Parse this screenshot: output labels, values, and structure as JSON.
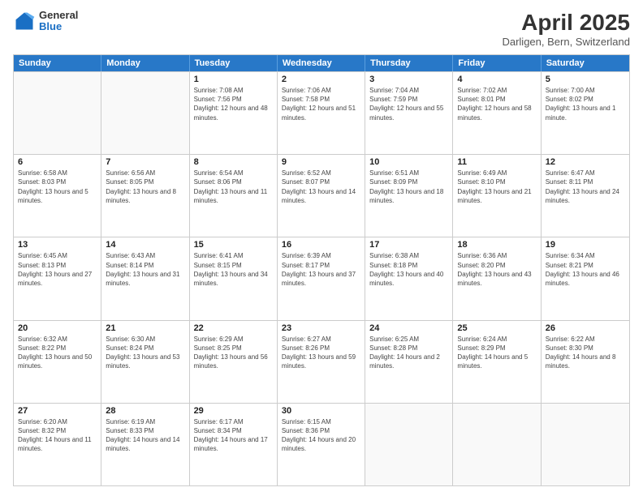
{
  "header": {
    "logo_general": "General",
    "logo_blue": "Blue",
    "title": "April 2025",
    "location": "Darligen, Bern, Switzerland"
  },
  "days_of_week": [
    "Sunday",
    "Monday",
    "Tuesday",
    "Wednesday",
    "Thursday",
    "Friday",
    "Saturday"
  ],
  "weeks": [
    [
      {
        "day": "",
        "empty": true
      },
      {
        "day": "",
        "empty": true
      },
      {
        "day": "1",
        "sunrise": "Sunrise: 7:08 AM",
        "sunset": "Sunset: 7:56 PM",
        "daylight": "Daylight: 12 hours and 48 minutes."
      },
      {
        "day": "2",
        "sunrise": "Sunrise: 7:06 AM",
        "sunset": "Sunset: 7:58 PM",
        "daylight": "Daylight: 12 hours and 51 minutes."
      },
      {
        "day": "3",
        "sunrise": "Sunrise: 7:04 AM",
        "sunset": "Sunset: 7:59 PM",
        "daylight": "Daylight: 12 hours and 55 minutes."
      },
      {
        "day": "4",
        "sunrise": "Sunrise: 7:02 AM",
        "sunset": "Sunset: 8:01 PM",
        "daylight": "Daylight: 12 hours and 58 minutes."
      },
      {
        "day": "5",
        "sunrise": "Sunrise: 7:00 AM",
        "sunset": "Sunset: 8:02 PM",
        "daylight": "Daylight: 13 hours and 1 minute."
      }
    ],
    [
      {
        "day": "6",
        "sunrise": "Sunrise: 6:58 AM",
        "sunset": "Sunset: 8:03 PM",
        "daylight": "Daylight: 13 hours and 5 minutes."
      },
      {
        "day": "7",
        "sunrise": "Sunrise: 6:56 AM",
        "sunset": "Sunset: 8:05 PM",
        "daylight": "Daylight: 13 hours and 8 minutes."
      },
      {
        "day": "8",
        "sunrise": "Sunrise: 6:54 AM",
        "sunset": "Sunset: 8:06 PM",
        "daylight": "Daylight: 13 hours and 11 minutes."
      },
      {
        "day": "9",
        "sunrise": "Sunrise: 6:52 AM",
        "sunset": "Sunset: 8:07 PM",
        "daylight": "Daylight: 13 hours and 14 minutes."
      },
      {
        "day": "10",
        "sunrise": "Sunrise: 6:51 AM",
        "sunset": "Sunset: 8:09 PM",
        "daylight": "Daylight: 13 hours and 18 minutes."
      },
      {
        "day": "11",
        "sunrise": "Sunrise: 6:49 AM",
        "sunset": "Sunset: 8:10 PM",
        "daylight": "Daylight: 13 hours and 21 minutes."
      },
      {
        "day": "12",
        "sunrise": "Sunrise: 6:47 AM",
        "sunset": "Sunset: 8:11 PM",
        "daylight": "Daylight: 13 hours and 24 minutes."
      }
    ],
    [
      {
        "day": "13",
        "sunrise": "Sunrise: 6:45 AM",
        "sunset": "Sunset: 8:13 PM",
        "daylight": "Daylight: 13 hours and 27 minutes."
      },
      {
        "day": "14",
        "sunrise": "Sunrise: 6:43 AM",
        "sunset": "Sunset: 8:14 PM",
        "daylight": "Daylight: 13 hours and 31 minutes."
      },
      {
        "day": "15",
        "sunrise": "Sunrise: 6:41 AM",
        "sunset": "Sunset: 8:15 PM",
        "daylight": "Daylight: 13 hours and 34 minutes."
      },
      {
        "day": "16",
        "sunrise": "Sunrise: 6:39 AM",
        "sunset": "Sunset: 8:17 PM",
        "daylight": "Daylight: 13 hours and 37 minutes."
      },
      {
        "day": "17",
        "sunrise": "Sunrise: 6:38 AM",
        "sunset": "Sunset: 8:18 PM",
        "daylight": "Daylight: 13 hours and 40 minutes."
      },
      {
        "day": "18",
        "sunrise": "Sunrise: 6:36 AM",
        "sunset": "Sunset: 8:20 PM",
        "daylight": "Daylight: 13 hours and 43 minutes."
      },
      {
        "day": "19",
        "sunrise": "Sunrise: 6:34 AM",
        "sunset": "Sunset: 8:21 PM",
        "daylight": "Daylight: 13 hours and 46 minutes."
      }
    ],
    [
      {
        "day": "20",
        "sunrise": "Sunrise: 6:32 AM",
        "sunset": "Sunset: 8:22 PM",
        "daylight": "Daylight: 13 hours and 50 minutes."
      },
      {
        "day": "21",
        "sunrise": "Sunrise: 6:30 AM",
        "sunset": "Sunset: 8:24 PM",
        "daylight": "Daylight: 13 hours and 53 minutes."
      },
      {
        "day": "22",
        "sunrise": "Sunrise: 6:29 AM",
        "sunset": "Sunset: 8:25 PM",
        "daylight": "Daylight: 13 hours and 56 minutes."
      },
      {
        "day": "23",
        "sunrise": "Sunrise: 6:27 AM",
        "sunset": "Sunset: 8:26 PM",
        "daylight": "Daylight: 13 hours and 59 minutes."
      },
      {
        "day": "24",
        "sunrise": "Sunrise: 6:25 AM",
        "sunset": "Sunset: 8:28 PM",
        "daylight": "Daylight: 14 hours and 2 minutes."
      },
      {
        "day": "25",
        "sunrise": "Sunrise: 6:24 AM",
        "sunset": "Sunset: 8:29 PM",
        "daylight": "Daylight: 14 hours and 5 minutes."
      },
      {
        "day": "26",
        "sunrise": "Sunrise: 6:22 AM",
        "sunset": "Sunset: 8:30 PM",
        "daylight": "Daylight: 14 hours and 8 minutes."
      }
    ],
    [
      {
        "day": "27",
        "sunrise": "Sunrise: 6:20 AM",
        "sunset": "Sunset: 8:32 PM",
        "daylight": "Daylight: 14 hours and 11 minutes."
      },
      {
        "day": "28",
        "sunrise": "Sunrise: 6:19 AM",
        "sunset": "Sunset: 8:33 PM",
        "daylight": "Daylight: 14 hours and 14 minutes."
      },
      {
        "day": "29",
        "sunrise": "Sunrise: 6:17 AM",
        "sunset": "Sunset: 8:34 PM",
        "daylight": "Daylight: 14 hours and 17 minutes."
      },
      {
        "day": "30",
        "sunrise": "Sunrise: 6:15 AM",
        "sunset": "Sunset: 8:36 PM",
        "daylight": "Daylight: 14 hours and 20 minutes."
      },
      {
        "day": "",
        "empty": true
      },
      {
        "day": "",
        "empty": true
      },
      {
        "day": "",
        "empty": true
      }
    ]
  ]
}
